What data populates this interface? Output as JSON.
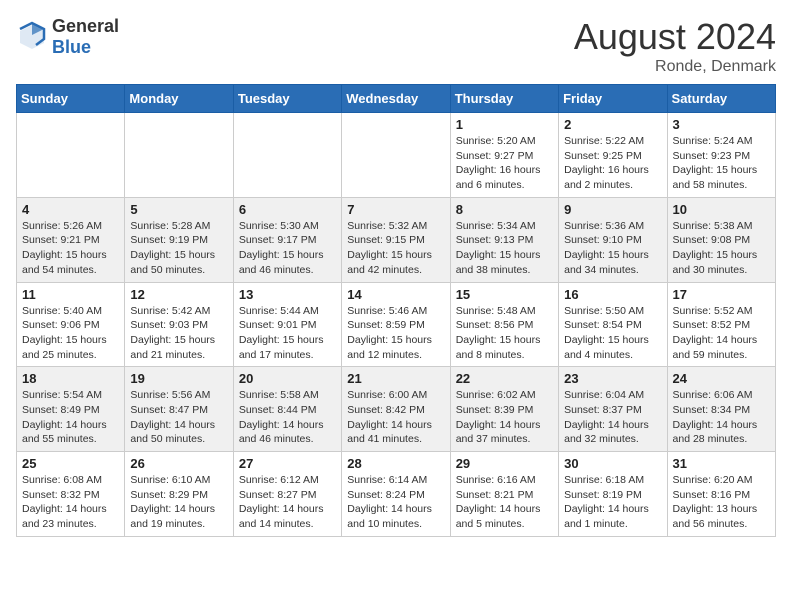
{
  "header": {
    "logo_general": "General",
    "logo_blue": "Blue",
    "month_year": "August 2024",
    "location": "Ronde, Denmark"
  },
  "weekdays": [
    "Sunday",
    "Monday",
    "Tuesday",
    "Wednesday",
    "Thursday",
    "Friday",
    "Saturday"
  ],
  "weeks": [
    [
      {
        "day": "",
        "info": ""
      },
      {
        "day": "",
        "info": ""
      },
      {
        "day": "",
        "info": ""
      },
      {
        "day": "",
        "info": ""
      },
      {
        "day": "1",
        "info": "Sunrise: 5:20 AM\nSunset: 9:27 PM\nDaylight: 16 hours\nand 6 minutes."
      },
      {
        "day": "2",
        "info": "Sunrise: 5:22 AM\nSunset: 9:25 PM\nDaylight: 16 hours\nand 2 minutes."
      },
      {
        "day": "3",
        "info": "Sunrise: 5:24 AM\nSunset: 9:23 PM\nDaylight: 15 hours\nand 58 minutes."
      }
    ],
    [
      {
        "day": "4",
        "info": "Sunrise: 5:26 AM\nSunset: 9:21 PM\nDaylight: 15 hours\nand 54 minutes."
      },
      {
        "day": "5",
        "info": "Sunrise: 5:28 AM\nSunset: 9:19 PM\nDaylight: 15 hours\nand 50 minutes."
      },
      {
        "day": "6",
        "info": "Sunrise: 5:30 AM\nSunset: 9:17 PM\nDaylight: 15 hours\nand 46 minutes."
      },
      {
        "day": "7",
        "info": "Sunrise: 5:32 AM\nSunset: 9:15 PM\nDaylight: 15 hours\nand 42 minutes."
      },
      {
        "day": "8",
        "info": "Sunrise: 5:34 AM\nSunset: 9:13 PM\nDaylight: 15 hours\nand 38 minutes."
      },
      {
        "day": "9",
        "info": "Sunrise: 5:36 AM\nSunset: 9:10 PM\nDaylight: 15 hours\nand 34 minutes."
      },
      {
        "day": "10",
        "info": "Sunrise: 5:38 AM\nSunset: 9:08 PM\nDaylight: 15 hours\nand 30 minutes."
      }
    ],
    [
      {
        "day": "11",
        "info": "Sunrise: 5:40 AM\nSunset: 9:06 PM\nDaylight: 15 hours\nand 25 minutes."
      },
      {
        "day": "12",
        "info": "Sunrise: 5:42 AM\nSunset: 9:03 PM\nDaylight: 15 hours\nand 21 minutes."
      },
      {
        "day": "13",
        "info": "Sunrise: 5:44 AM\nSunset: 9:01 PM\nDaylight: 15 hours\nand 17 minutes."
      },
      {
        "day": "14",
        "info": "Sunrise: 5:46 AM\nSunset: 8:59 PM\nDaylight: 15 hours\nand 12 minutes."
      },
      {
        "day": "15",
        "info": "Sunrise: 5:48 AM\nSunset: 8:56 PM\nDaylight: 15 hours\nand 8 minutes."
      },
      {
        "day": "16",
        "info": "Sunrise: 5:50 AM\nSunset: 8:54 PM\nDaylight: 15 hours\nand 4 minutes."
      },
      {
        "day": "17",
        "info": "Sunrise: 5:52 AM\nSunset: 8:52 PM\nDaylight: 14 hours\nand 59 minutes."
      }
    ],
    [
      {
        "day": "18",
        "info": "Sunrise: 5:54 AM\nSunset: 8:49 PM\nDaylight: 14 hours\nand 55 minutes."
      },
      {
        "day": "19",
        "info": "Sunrise: 5:56 AM\nSunset: 8:47 PM\nDaylight: 14 hours\nand 50 minutes."
      },
      {
        "day": "20",
        "info": "Sunrise: 5:58 AM\nSunset: 8:44 PM\nDaylight: 14 hours\nand 46 minutes."
      },
      {
        "day": "21",
        "info": "Sunrise: 6:00 AM\nSunset: 8:42 PM\nDaylight: 14 hours\nand 41 minutes."
      },
      {
        "day": "22",
        "info": "Sunrise: 6:02 AM\nSunset: 8:39 PM\nDaylight: 14 hours\nand 37 minutes."
      },
      {
        "day": "23",
        "info": "Sunrise: 6:04 AM\nSunset: 8:37 PM\nDaylight: 14 hours\nand 32 minutes."
      },
      {
        "day": "24",
        "info": "Sunrise: 6:06 AM\nSunset: 8:34 PM\nDaylight: 14 hours\nand 28 minutes."
      }
    ],
    [
      {
        "day": "25",
        "info": "Sunrise: 6:08 AM\nSunset: 8:32 PM\nDaylight: 14 hours\nand 23 minutes."
      },
      {
        "day": "26",
        "info": "Sunrise: 6:10 AM\nSunset: 8:29 PM\nDaylight: 14 hours\nand 19 minutes."
      },
      {
        "day": "27",
        "info": "Sunrise: 6:12 AM\nSunset: 8:27 PM\nDaylight: 14 hours\nand 14 minutes."
      },
      {
        "day": "28",
        "info": "Sunrise: 6:14 AM\nSunset: 8:24 PM\nDaylight: 14 hours\nand 10 minutes."
      },
      {
        "day": "29",
        "info": "Sunrise: 6:16 AM\nSunset: 8:21 PM\nDaylight: 14 hours\nand 5 minutes."
      },
      {
        "day": "30",
        "info": "Sunrise: 6:18 AM\nSunset: 8:19 PM\nDaylight: 14 hours\nand 1 minute."
      },
      {
        "day": "31",
        "info": "Sunrise: 6:20 AM\nSunset: 8:16 PM\nDaylight: 13 hours\nand 56 minutes."
      }
    ]
  ]
}
